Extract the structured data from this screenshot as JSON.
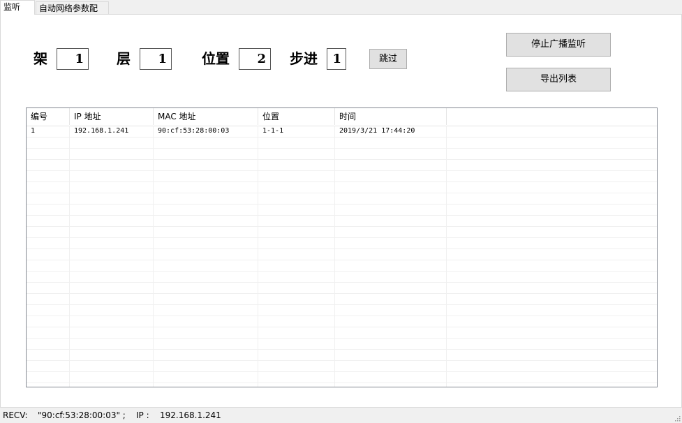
{
  "tabs": [
    {
      "label": "监听",
      "active": true
    },
    {
      "label": "自动网络参数配置",
      "active": false
    }
  ],
  "controls": {
    "rack_label": "架",
    "rack_value": "1",
    "layer_label": "层",
    "layer_value": "1",
    "position_label": "位置",
    "position_value": "2",
    "step_label": "步进",
    "step_value": "1",
    "skip_button": "跳过",
    "stop_button": "停止广播监听",
    "export_button": "导出列表"
  },
  "table": {
    "columns": [
      "编号",
      "IP 地址",
      "MAC 地址",
      "位置",
      "时间"
    ],
    "rows": [
      [
        "1",
        "192.168.1.241",
        "90:cf:53:28:00:03",
        "1-1-1",
        "2019/3/21 17:44:20"
      ]
    ]
  },
  "status_bar": {
    "recv_label": "RECV:",
    "recv_value": "\"90:cf:53:28:00:03\" ;",
    "ip_label": "IP :",
    "ip_value": "192.168.1.241"
  }
}
